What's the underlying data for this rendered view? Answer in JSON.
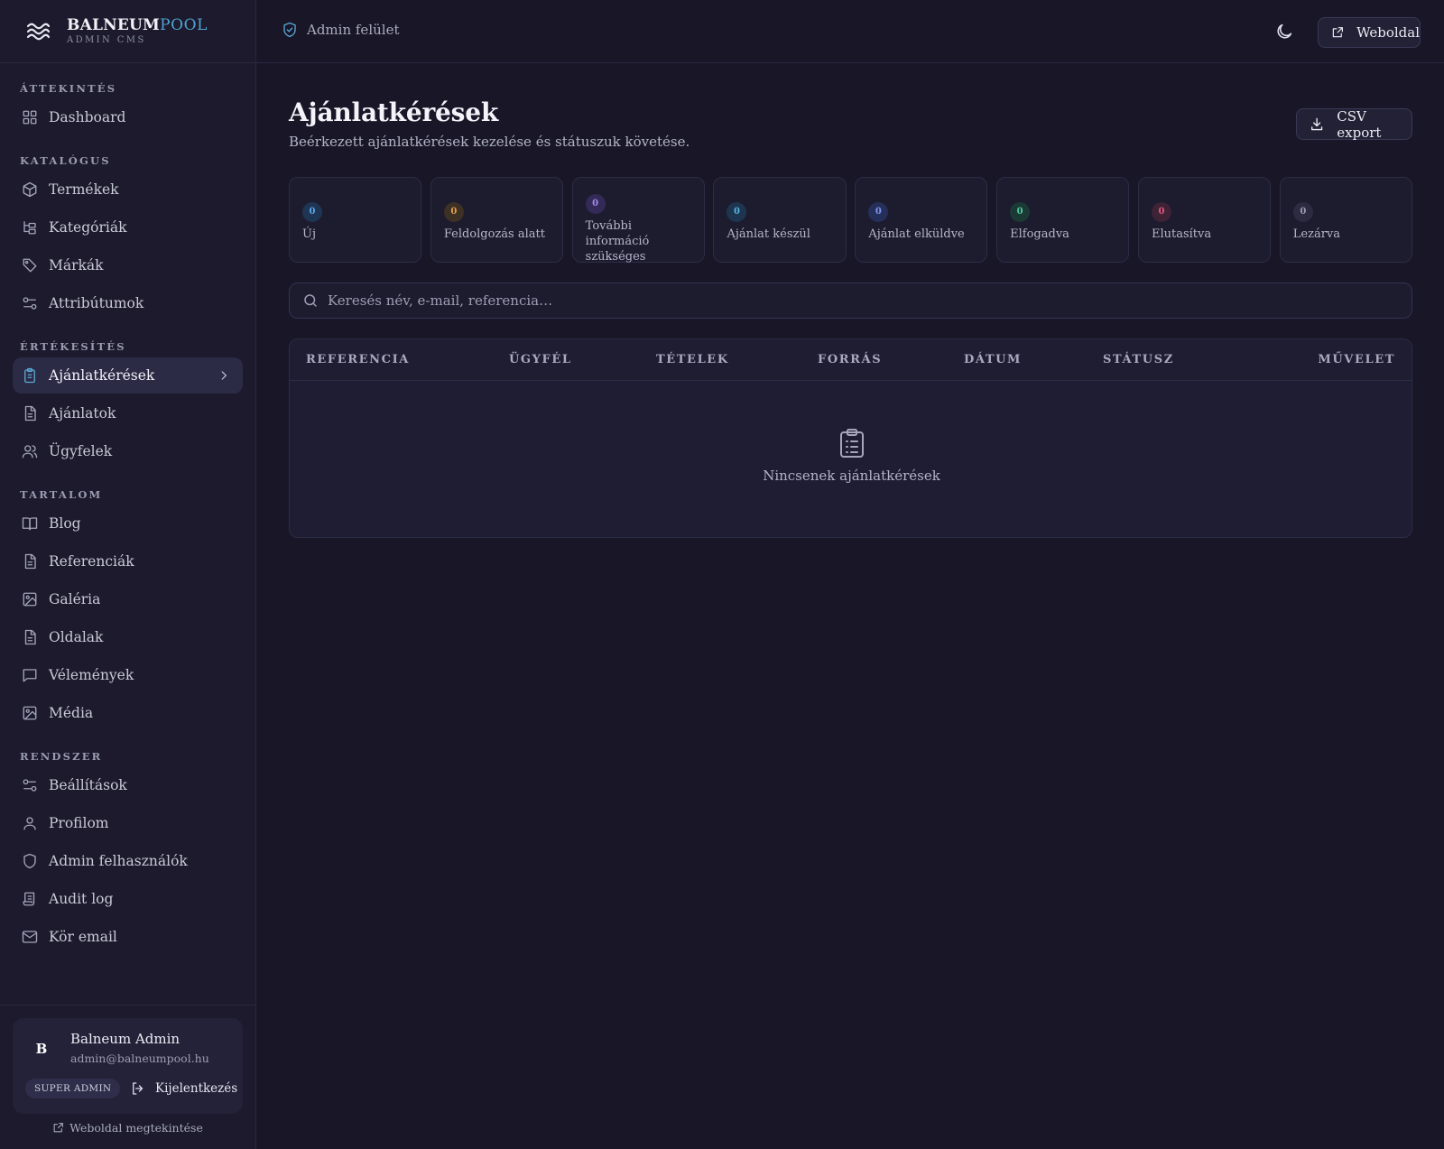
{
  "brand": {
    "name_part1": "BALNEUM",
    "name_part2": "POOL",
    "subtitle": "ADMIN CMS"
  },
  "sidebar": {
    "sections": [
      {
        "title": "ÁTTEKINTÉS",
        "items": [
          {
            "label": "Dashboard",
            "icon": "dashboard-icon"
          }
        ]
      },
      {
        "title": "KATALÓGUS",
        "items": [
          {
            "label": "Termékek",
            "icon": "box-icon"
          },
          {
            "label": "Kategóriák",
            "icon": "tree-icon"
          },
          {
            "label": "Márkák",
            "icon": "tag-icon"
          },
          {
            "label": "Attribútumok",
            "icon": "sliders-icon"
          }
        ]
      },
      {
        "title": "ÉRTÉKESÍTÉS",
        "items": [
          {
            "label": "Ajánlatkérések",
            "icon": "clipboard-icon",
            "active": true
          },
          {
            "label": "Ajánlatok",
            "icon": "document-icon"
          },
          {
            "label": "Ügyfelek",
            "icon": "users-icon"
          }
        ]
      },
      {
        "title": "TARTALOM",
        "items": [
          {
            "label": "Blog",
            "icon": "book-icon"
          },
          {
            "label": "Referenciák",
            "icon": "document-icon"
          },
          {
            "label": "Galéria",
            "icon": "image-icon"
          },
          {
            "label": "Oldalak",
            "icon": "document-icon"
          },
          {
            "label": "Vélemények",
            "icon": "message-icon"
          },
          {
            "label": "Média",
            "icon": "image-icon"
          }
        ]
      },
      {
        "title": "RENDSZER",
        "items": [
          {
            "label": "Beállítások",
            "icon": "sliders-icon"
          },
          {
            "label": "Profilom",
            "icon": "user-icon"
          },
          {
            "label": "Admin felhasználók",
            "icon": "shield-icon"
          },
          {
            "label": "Audit log",
            "icon": "scroll-icon"
          },
          {
            "label": "Kör email",
            "icon": "mail-icon"
          }
        ]
      }
    ]
  },
  "user": {
    "initial": "B",
    "name": "Balneum Admin",
    "email": "admin@balneumpool.hu",
    "role": "SUPER ADMIN",
    "logout_label": "Kijelentkezés",
    "view_site_label": "Weboldal megtekintése"
  },
  "topbar": {
    "admin_label": "Admin felület",
    "website_label": "Weboldal"
  },
  "page": {
    "title": "Ajánlatkérések",
    "subtitle": "Beérkezett ajánlatkérések kezelése és státuszuk követése.",
    "csv_label": "CSV export"
  },
  "stats": [
    {
      "count": "0",
      "label": "Új",
      "bg": "#1f3554",
      "fg": "#5aa7e6"
    },
    {
      "count": "0",
      "label": "Feldolgozás alatt",
      "bg": "#3d3025",
      "fg": "#e0a24a"
    },
    {
      "count": "0",
      "label": "További információ szükséges",
      "bg": "#342a57",
      "fg": "#a48be8"
    },
    {
      "count": "0",
      "label": "Ajánlat készül",
      "bg": "#1e3550",
      "fg": "#55b4e0"
    },
    {
      "count": "0",
      "label": "Ajánlat elküldve",
      "bg": "#25305a",
      "fg": "#7f95ee"
    },
    {
      "count": "0",
      "label": "Elfogadva",
      "bg": "#1c3a35",
      "fg": "#4fc79a"
    },
    {
      "count": "0",
      "label": "Elutasítva",
      "bg": "#3e2337",
      "fg": "#e0557c"
    },
    {
      "count": "0",
      "label": "Lezárva",
      "bg": "#2c2b40",
      "fg": "#9b9cb2"
    }
  ],
  "search": {
    "placeholder": "Keresés név, e-mail, referencia…"
  },
  "table": {
    "columns": [
      "REFERENCIA",
      "ÜGYFÉL",
      "TÉTELEK",
      "FORRÁS",
      "DÁTUM",
      "STÁTUSZ",
      "MŰVELET"
    ],
    "empty_message": "Nincsenek ajánlatkérések"
  }
}
